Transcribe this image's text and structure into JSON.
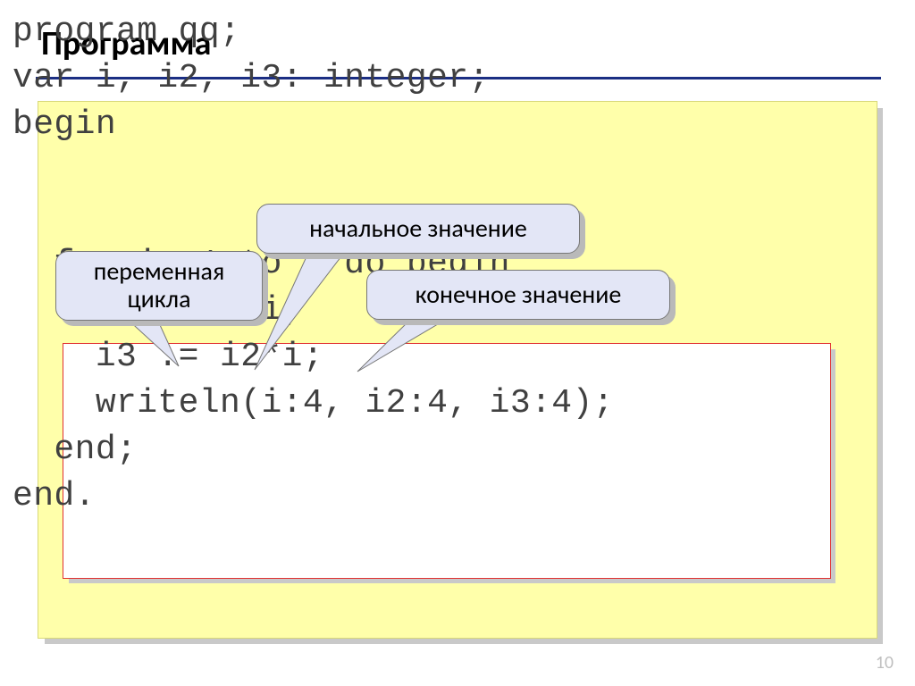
{
  "title": "Программа",
  "slide_number": "10",
  "code": {
    "line1": "program qq;",
    "line2": "var i, i2, i3: integer;",
    "line3": "begin",
    "line4": "  for i:=1 to 8 do begin",
    "line5": "    i2 := i*i;",
    "line6": "    i3 := i2*i;",
    "line7": "    writeln(i:4, i2:4, i3:4);",
    "line8": "  end;",
    "line9": "end."
  },
  "callouts": {
    "start_value": "начальное значение",
    "end_value": "конечное значение",
    "loop_var_l1": "переменная",
    "loop_var_l2": "цикла"
  }
}
